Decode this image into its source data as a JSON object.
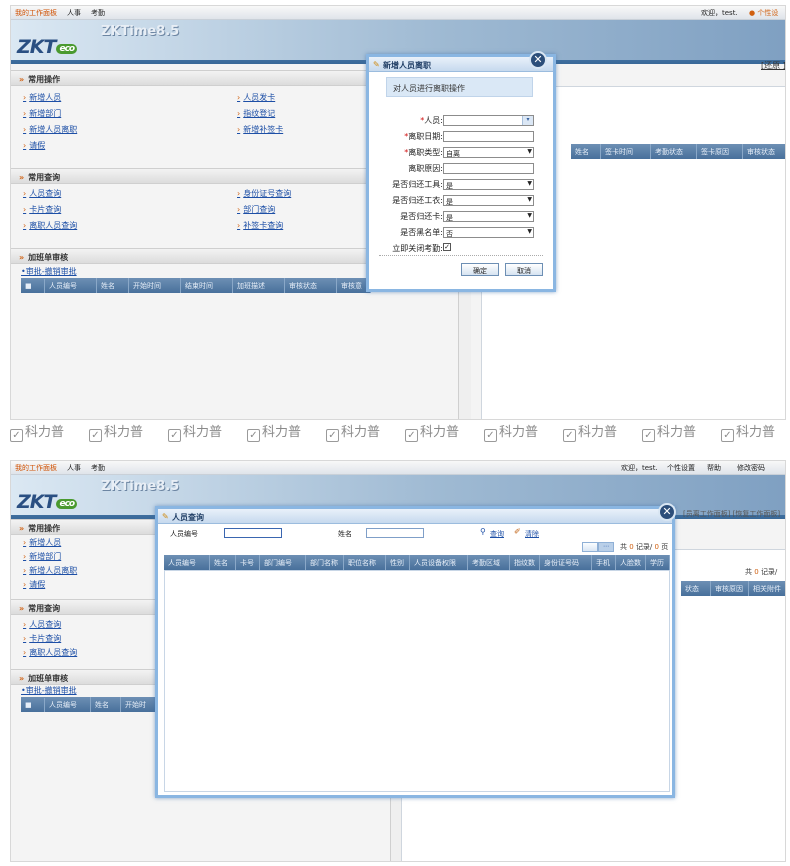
{
  "menu": {
    "work_panel": "我的工作面板",
    "hr": "人事",
    "attendance": "考勤",
    "welcome": "欢迎，test.",
    "personal_setting": "● 个性设",
    "personal_setting_full": "个性设置",
    "help": "帮助",
    "change_password": "修改密码"
  },
  "brand": {
    "logo_text": "ZKT",
    "logo_eco": "eco",
    "product": "ZKTime8.5"
  },
  "common_ops": {
    "title": "常用操作",
    "items": [
      "新增人员",
      "人员发卡",
      "新增部门",
      "指纹登记",
      "新增人员离职",
      "新增补签卡",
      "请假"
    ]
  },
  "common_query": {
    "title": "常用查询",
    "items": [
      "人员查询",
      "身份证号查询",
      "卡片查询",
      "部门查询",
      "离职人员查询",
      "补签卡查询"
    ]
  },
  "overtime": {
    "title": "加班单审核",
    "tabs": "•审批-撤销审批",
    "columns": [
      "",
      "人员编号",
      "姓名",
      "开始时间",
      "结束时间",
      "加班描述",
      "审核状态",
      "审核意"
    ],
    "columns_short": [
      "",
      "人员编号",
      "姓名",
      "开始时"
    ]
  },
  "right_panel": {
    "restore": "[还原 ]",
    "columns": [
      "姓名",
      "签卡时间",
      "考勤状态",
      "签卡原因",
      "审核状态"
    ],
    "records_prefix": "共",
    "records_count": "0",
    "records_suffix": "记录/",
    "pages_count": "0",
    "pages_suffix": "页",
    "columns2": [
      "状态",
      "审核原因",
      "相关附件"
    ],
    "links": "[员离工作面板] [恢复工作面板]"
  },
  "resign_dialog": {
    "title": "新增人员离职",
    "hint": "对人员进行离职操作",
    "fields": [
      {
        "label": "人员:",
        "required": true,
        "value": "",
        "type": "select-blue"
      },
      {
        "label": "离职日期:",
        "required": true,
        "value": "",
        "type": "text"
      },
      {
        "label": "离职类型:",
        "required": true,
        "value": "自离",
        "type": "select"
      },
      {
        "label": "离职原因:",
        "required": false,
        "value": "",
        "type": "text"
      },
      {
        "label": "是否归还工具:",
        "required": false,
        "value": "是",
        "type": "select"
      },
      {
        "label": "是否归还工衣:",
        "required": false,
        "value": "是",
        "type": "select"
      },
      {
        "label": "是否归还卡:",
        "required": false,
        "value": "是",
        "type": "select"
      },
      {
        "label": "是否黑名单:",
        "required": false,
        "value": "否",
        "type": "select"
      },
      {
        "label": "立即关闭考勤:",
        "required": false,
        "value": "checked",
        "type": "checkbox"
      }
    ],
    "ok": "确定",
    "cancel": "取消"
  },
  "query_dialog": {
    "title": "人员查询",
    "emp_no_label": "人员编号",
    "name_label": "姓名",
    "search": "查询",
    "clear": "清除",
    "records_prefix": "共",
    "records_count": "0",
    "records_suffix": "记录/",
    "pages_count": "0",
    "pages_suffix": "页",
    "columns": [
      "人员编号",
      "姓名",
      "卡号",
      "部门编号",
      "部门名称",
      "职位名称",
      "性别",
      "人员设备权限",
      "考勤区域",
      "指纹数",
      "身份证号码",
      "手机",
      "人脸数",
      "学历"
    ]
  },
  "watermark": "科力普",
  "colors": {
    "menu_accent": "#d05000",
    "header_blue": "#48709b",
    "link_blue": "#1d4fa6",
    "required_red": "#d01010",
    "dialog_border": "#8ab6e2"
  }
}
